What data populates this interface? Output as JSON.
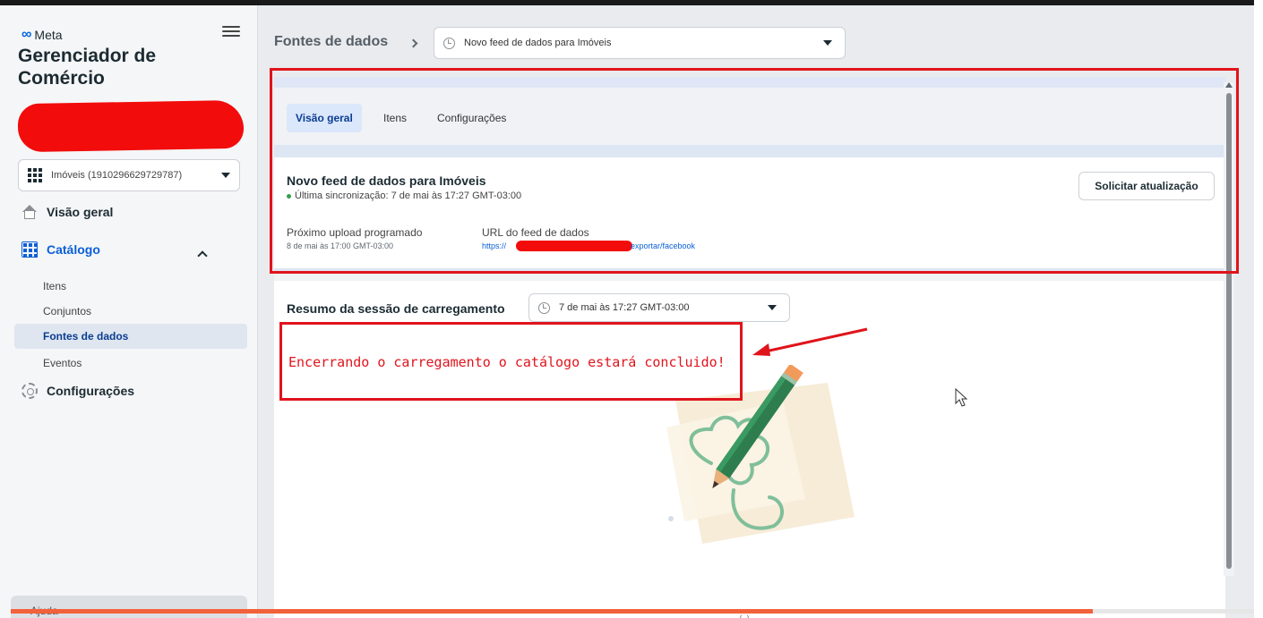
{
  "sidebar": {
    "brand": "Meta",
    "app_title": "Gerenciador de Comércio",
    "catalog_select": "Imóveis (1910296629729787)",
    "nav": {
      "overview": "Visão geral",
      "catalog": "Catálogo",
      "settings": "Configurações"
    },
    "catalog_items": [
      "Itens",
      "Conjuntos",
      "Fontes de dados",
      "Eventos"
    ],
    "active_item": "Fontes de dados",
    "help": "Ajuda"
  },
  "header": {
    "breadcrumb": "Fontes de dados",
    "feed_select": "Novo feed de dados para Imóveis"
  },
  "tabs": [
    "Visão geral",
    "Itens",
    "Configurações"
  ],
  "active_tab": "Visão geral",
  "feed": {
    "title": "Novo feed de dados para Imóveis",
    "sync": "Última sincronização: 7 de mai às 17:27 GMT-03:00",
    "request_button": "Solicitar atualização",
    "next_upload_label": "Próximo upload programado",
    "next_upload_value": "8 de mai às 17:00 GMT-03:00",
    "url_label": "URL do feed de dados",
    "url_prefix": "https://",
    "url_suffix": "exportar/facebook"
  },
  "session": {
    "title": "Resumo da sessão de carregamento",
    "select": "7 de mai às 17:27 GMT-03:00"
  },
  "annotation": {
    "text": "Encerrando o carregamento o catálogo estará concluido!",
    "color": "#e0141c"
  },
  "video": {
    "progress": 0.87,
    "progress_color": "#f2613a"
  },
  "colors": {
    "accent": "#0a5fd8",
    "sync_dot": "#31a24c",
    "redaction": "#f20c0c"
  }
}
